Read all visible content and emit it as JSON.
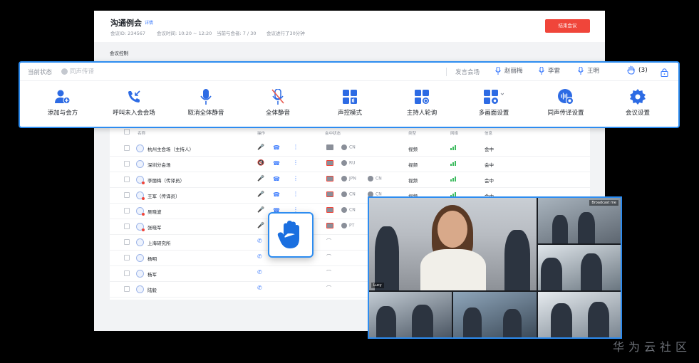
{
  "header": {
    "title": "沟通例会",
    "detail_link": "详情",
    "meeting_id": "会议ID: 234567",
    "meeting_time": "会议时间: 10:20 ~ 12:20",
    "participants": "当前与会者: 7 / 30",
    "elapsed": "会议进行了30分钟",
    "end_button": "结束会议"
  },
  "section_label": "会议控制",
  "toolbar": {
    "current_state_label": "当前状态",
    "translation_state": "同声传译",
    "speaker_label": "发言会场",
    "speakers": [
      "赵丽梅",
      "李雷",
      "王明"
    ],
    "hand_count": "(3)",
    "controls": [
      {
        "label": "添加与会方",
        "icon": "add-participant-icon"
      },
      {
        "label": "呼叫未入会会场",
        "icon": "call-missed-icon"
      },
      {
        "label": "取消全体静音",
        "icon": "microphone-icon"
      },
      {
        "label": "全体静音",
        "icon": "microphone-muted-icon"
      },
      {
        "label": "声控模式",
        "icon": "voice-control-icon"
      },
      {
        "label": "主持人轮询",
        "icon": "host-poll-icon"
      },
      {
        "label": "多画面设置",
        "icon": "multi-screen-icon"
      },
      {
        "label": "同声传译设置",
        "icon": "interpretation-icon"
      },
      {
        "label": "会议设置",
        "icon": "gear-icon"
      }
    ]
  },
  "table": {
    "columns": [
      "名称",
      "操作",
      "会中状态",
      "类型",
      "网络",
      "信息"
    ],
    "rows": [
      {
        "name": "杭州主会场（主持人）",
        "langs": [
          "CN"
        ],
        "type": "视频",
        "status": "会中"
      },
      {
        "name": "深圳分会场",
        "langs": [
          "RU"
        ],
        "type": "视频",
        "status": "会中"
      },
      {
        "name": "李丽梅（传译员）",
        "langs": [
          "JPN",
          "CN"
        ],
        "type": "视频",
        "status": "会中"
      },
      {
        "name": "王军（传译员）",
        "langs": [
          "CN",
          "CN"
        ],
        "type": "视频",
        "status": "会中"
      },
      {
        "name": "吴晓波",
        "langs": [
          "CN"
        ],
        "type": "",
        "status": ""
      },
      {
        "name": "张晓军",
        "langs": [
          "PT"
        ],
        "type": "",
        "status": ""
      },
      {
        "name": "上海研究所",
        "langs": [],
        "type": "",
        "status": ""
      },
      {
        "name": "杨明",
        "langs": [],
        "type": "",
        "status": ""
      },
      {
        "name": "杨军",
        "langs": [],
        "type": "",
        "status": ""
      },
      {
        "name": "陆毅",
        "langs": [],
        "type": "",
        "status": ""
      }
    ]
  },
  "video": {
    "main_label": "Lucy",
    "broadcast_label": "Broadcast me"
  },
  "watermark": "华为云社区",
  "colors": {
    "accent": "#2d8cf0",
    "danger": "#f0453a",
    "link": "#3a7afe"
  }
}
